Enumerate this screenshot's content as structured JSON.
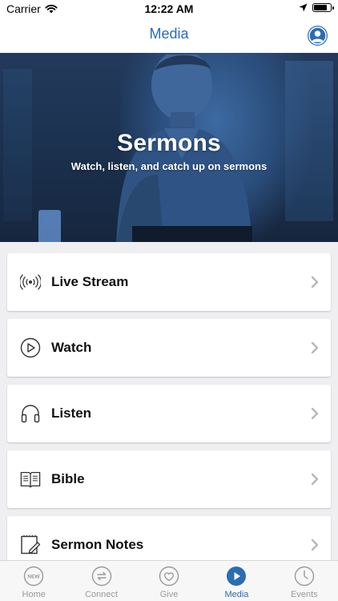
{
  "status_bar": {
    "carrier": "Carrier",
    "time": "12:22 AM"
  },
  "nav": {
    "title": "Media"
  },
  "hero": {
    "title": "Sermons",
    "subtitle": "Watch, listen, and catch up on sermons"
  },
  "menu": {
    "items": [
      {
        "label": "Live Stream",
        "icon": "broadcast-icon"
      },
      {
        "label": "Watch",
        "icon": "play-circle-icon"
      },
      {
        "label": "Listen",
        "icon": "headphones-icon"
      },
      {
        "label": "Bible",
        "icon": "book-icon"
      },
      {
        "label": "Sermon Notes",
        "icon": "notes-icon"
      }
    ]
  },
  "tab_bar": {
    "tabs": [
      {
        "label": "Home",
        "icon": "new-badge-icon",
        "badge": "NEW"
      },
      {
        "label": "Connect",
        "icon": "connect-icon"
      },
      {
        "label": "Give",
        "icon": "heart-icon"
      },
      {
        "label": "Media",
        "icon": "play-icon",
        "active": true
      },
      {
        "label": "Events",
        "icon": "clock-icon"
      }
    ]
  },
  "colors": {
    "accent": "#2c6cb3",
    "inactive": "#9a9a9a",
    "hero_tint": "#1c3352"
  }
}
